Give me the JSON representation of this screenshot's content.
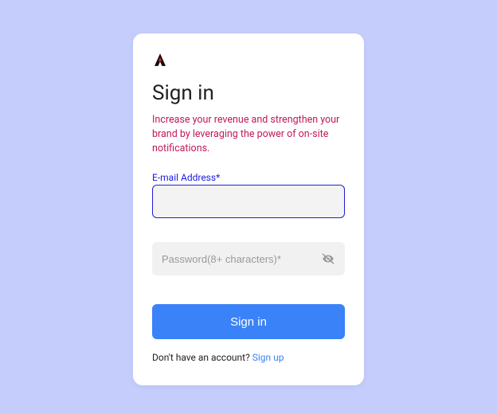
{
  "title": "Sign in",
  "subtitle": "Increase your revenue and strengthen your brand by leveraging the power of on-site notifications.",
  "email": {
    "label": "E-mail Address*",
    "value": ""
  },
  "password": {
    "placeholder": "Password(8+ characters)*",
    "value": ""
  },
  "signin_button": "Sign in",
  "signup_prompt": "Don't have an account? ",
  "signup_link": "Sign up"
}
